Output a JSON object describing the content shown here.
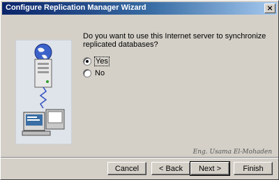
{
  "window": {
    "title": "Configure Replication Manager Wizard",
    "close_glyph": "×"
  },
  "question": "Do you want to use this Internet server to synchronize replicated databases?",
  "options": [
    {
      "label": "Yes",
      "selected": true
    },
    {
      "label": "No",
      "selected": false
    }
  ],
  "buttons": {
    "cancel": "Cancel",
    "back": "< Back",
    "next": "Next >",
    "finish": "Finish"
  },
  "signature": "Eng. Usama El-Mohaden",
  "colors": {
    "title_start": "#0a246a",
    "title_end": "#a6caf0",
    "face": "#d4d0c8",
    "art_bg": "#dfe3ea"
  }
}
